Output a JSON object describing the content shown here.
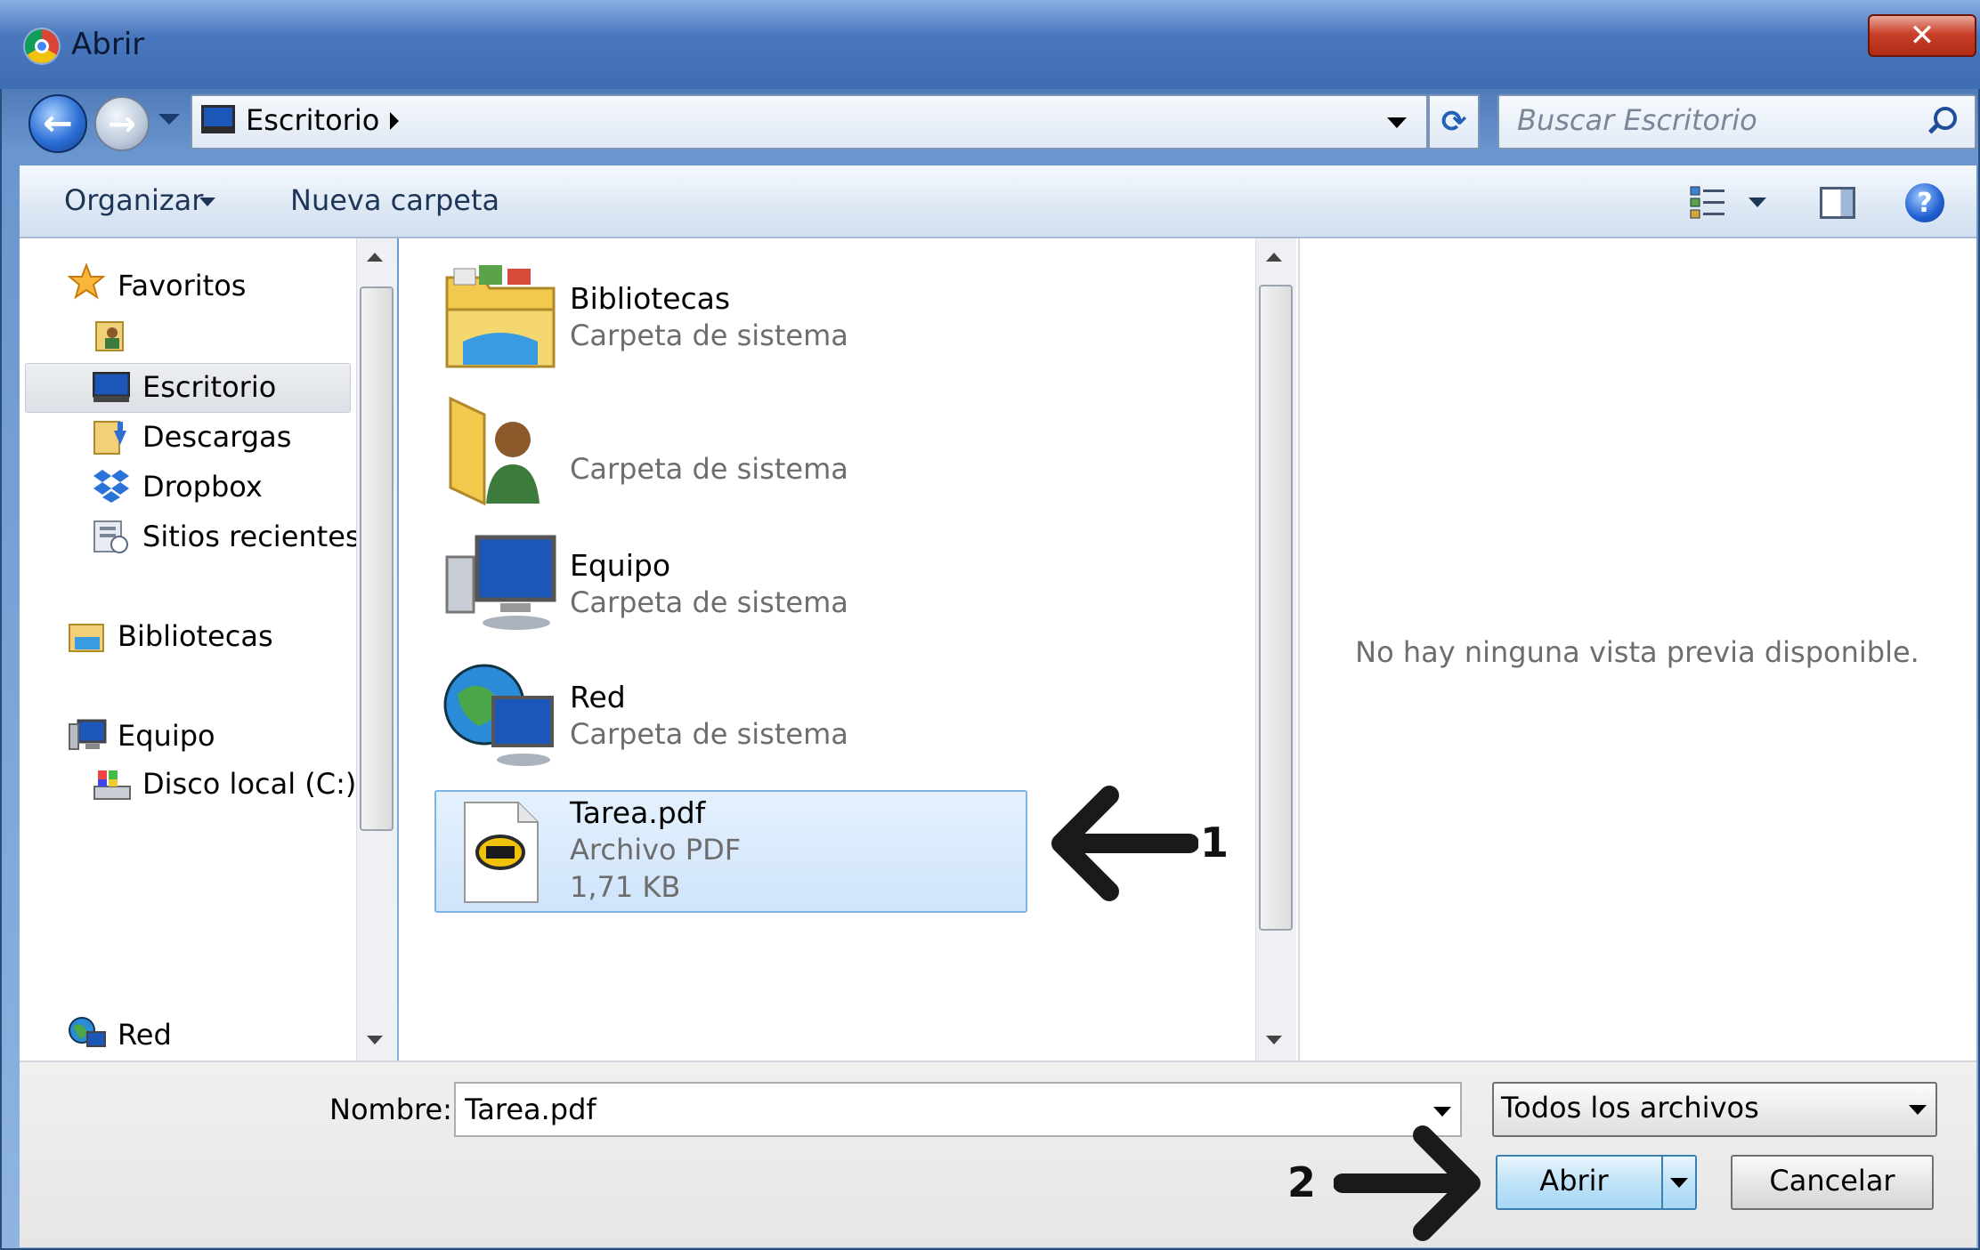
{
  "window": {
    "title": "Abrir",
    "close_glyph": "✕"
  },
  "address": {
    "location": "Escritorio",
    "search_placeholder": "Buscar Escritorio"
  },
  "toolbar": {
    "organize_label": "Organizar",
    "new_folder_label": "Nueva carpeta",
    "help_glyph": "?"
  },
  "nav": {
    "favorites_label": "Favoritos",
    "items": [
      {
        "label": "Escritorio",
        "icon": "desktop-icon",
        "selected": true
      },
      {
        "label": "Descargas",
        "icon": "downloads-folder-icon"
      },
      {
        "label": "Dropbox",
        "icon": "dropbox-icon"
      },
      {
        "label": "Sitios recientes",
        "icon": "recent-places-icon"
      }
    ],
    "libraries_label": "Bibliotecas",
    "computer_label": "Equipo",
    "local_disk_label": "Disco local (C:)",
    "network_label": "Red"
  },
  "files": [
    {
      "name": "Bibliotecas",
      "type": "Carpeta de sistema",
      "icon": "libraries-folder-icon"
    },
    {
      "name": "",
      "type": "Carpeta de sistema",
      "icon": "user-folder-icon"
    },
    {
      "name": "Equipo",
      "type": "Carpeta de sistema",
      "icon": "computer-icon"
    },
    {
      "name": "Red",
      "type": "Carpeta de sistema",
      "icon": "network-icon"
    },
    {
      "name": "Tarea.pdf",
      "type": "Archivo PDF",
      "size": "1,71 KB",
      "icon": "pdf-file-icon",
      "selected": true
    }
  ],
  "preview": {
    "message": "No hay ninguna vista previa disponible."
  },
  "footer": {
    "name_label": "Nombre:",
    "name_value": "Tarea.pdf",
    "filetype_value": "Todos los archivos",
    "open_label": "Abrir",
    "cancel_label": "Cancelar"
  },
  "annotations": {
    "step1": "1",
    "step2": "2"
  },
  "colors": {
    "titlebar": "#4a78be",
    "selection": "#cfe4fb",
    "selection_border": "#7eb3e8"
  }
}
